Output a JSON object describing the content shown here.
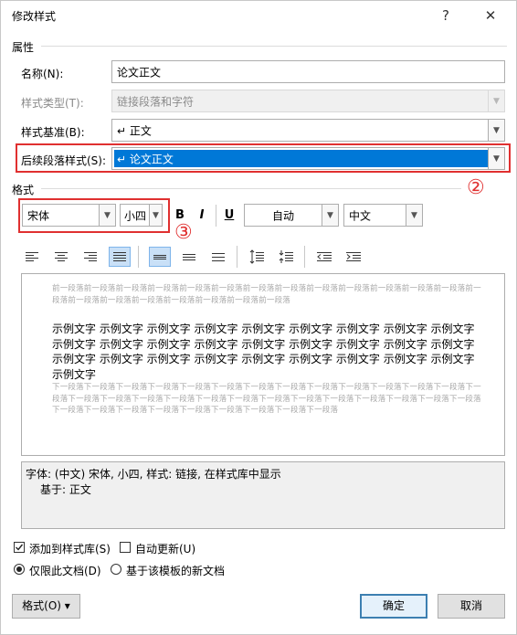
{
  "title": "修改样式",
  "title_buttons": {
    "help": "?",
    "close": "✕"
  },
  "section_properties": "属性",
  "name": {
    "label": "名称(N):",
    "value": "论文正文"
  },
  "style_type": {
    "label": "样式类型(T):",
    "value": "链接段落和字符"
  },
  "based_on": {
    "label": "样式基准(B):",
    "value": "↵ 正文"
  },
  "next_style": {
    "label": "后续段落样式(S):",
    "value": "↵ 论文正文"
  },
  "annotations": {
    "two": "②",
    "three": "③"
  },
  "section_format": "格式",
  "font": {
    "name": "宋体",
    "size": "小四",
    "bold": "B",
    "italic": "I",
    "underline": "U",
    "color": "自动",
    "script": "中文"
  },
  "preview": {
    "prev_para": "前一段落前一段落前一段落前一段落前一段落前一段落前一段落前一段落前一段落前一段落前一段落前一段落前一段落前一段落前一段落前一段落前一段落前一段落前一段落前一段落前一段落",
    "sample": "示例文字 示例文字 示例文字 示例文字 示例文字 示例文字 示例文字 示例文字 示例文字 示例文字 示例文字 示例文字 示例文字 示例文字 示例文字 示例文字 示例文字 示例文字 示例文字 示例文字 示例文字 示例文字 示例文字 示例文字 示例文字 示例文字 示例文字 示例文字",
    "next_para": "下一段落下一段落下一段落下一段落下一段落下一段落下一段落下一段落下一段落下一段落下一段落下一段落下一段落下一段落下一段落下一段落下一段落下一段落下一段落下一段落下一段落下一段落下一段落下一段落下一段落下一段落下一段落下一段落下一段落下一段落下一段落下一段落下一段落下一段落下一段落下一段落"
  },
  "description": {
    "line1": "字体: (中文) 宋体, 小四, 样式: 链接, 在样式库中显示",
    "line2": "基于: 正文"
  },
  "options": {
    "add_gallery": {
      "label": "添加到样式库(S)",
      "checked": true
    },
    "auto_update": {
      "label": "自动更新(U)",
      "checked": false
    },
    "only_doc": {
      "label": "仅限此文档(D)",
      "selected": true
    },
    "new_docs": {
      "label": "基于该模板的新文档",
      "selected": false
    }
  },
  "buttons": {
    "format": "格式(O) ▾",
    "ok": "确定",
    "cancel": "取消"
  }
}
